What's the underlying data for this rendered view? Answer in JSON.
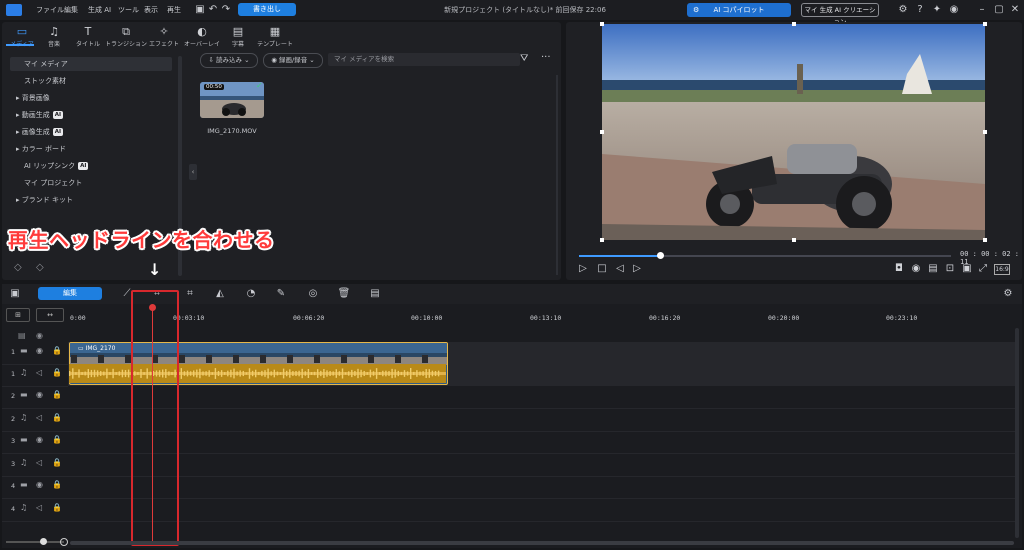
{
  "menu": [
    "ファイル",
    "編集",
    "生成 AI",
    "ツール",
    "表示",
    "再生"
  ],
  "export_label": "書き出し",
  "project_title": "新規プロジェクト (タイトルなし)* 前回保存 22:06",
  "ai_copilot_label": "AI コパイロット",
  "ai_creation_label": "マイ 生成 AI クリエーション",
  "library_tabs": [
    "メディア",
    "音楽",
    "タイトル",
    "トランジション",
    "エフェクト",
    "オーバーレイ",
    "字幕",
    "テンプレート"
  ],
  "sidebar": [
    {
      "label": "マイ メディア",
      "ai": false
    },
    {
      "label": "ストック素材",
      "ai": false
    },
    {
      "label": "背景画像",
      "ai": false
    },
    {
      "label": "動画生成",
      "ai": true
    },
    {
      "label": "画像生成",
      "ai": true
    },
    {
      "label": "カラー ボード",
      "ai": false
    },
    {
      "label": "AI リップシンク",
      "ai": true
    },
    {
      "label": "マイ プロジェクト",
      "ai": false
    },
    {
      "label": "ブランド キット",
      "ai": false
    }
  ],
  "ai_badge": "AI",
  "import_label": "読み込み",
  "record_label": "録画/録音",
  "search_placeholder": "マイ メディアを検索",
  "thumb_duration": "00:50",
  "media_file": "IMG_2170.MOV",
  "timecode": "00 : 00 : 02 : 11",
  "edit_label": "編集",
  "ruler_labels": [
    "0:00",
    "00:03:10",
    "00:06:20",
    "00:10:00",
    "00:13:10",
    "00:16:20",
    "00:20:00",
    "00:23:10"
  ],
  "clip_name": "IMG_2170",
  "track_numbers": [
    "1",
    "1",
    "2",
    "2",
    "3",
    "3",
    "4",
    "4"
  ],
  "annotation": "再生ヘッドラインを合わせる",
  "colors": {
    "accent": "#1e7fe0",
    "playhead": "#e03a3a",
    "clip_border": "#e6b84a",
    "annotation": "#ff3b3b"
  }
}
